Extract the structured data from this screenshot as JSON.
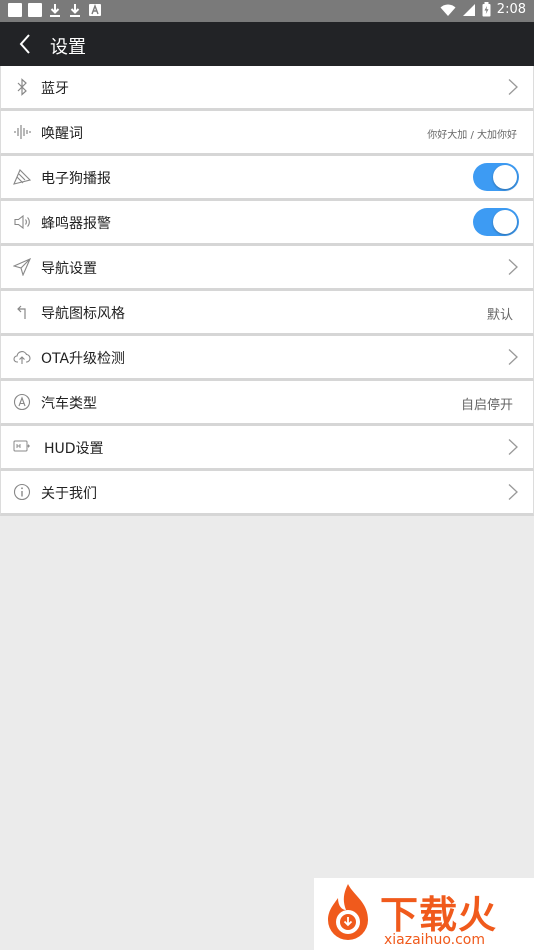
{
  "status_bar": {
    "time": "2:08"
  },
  "header": {
    "title": "设置"
  },
  "settings": [
    {
      "label": "蓝牙",
      "icon": "bluetooth-icon",
      "trailing": "chevron"
    },
    {
      "label": "唤醒词",
      "icon": "voice-wave-icon",
      "trailing": "value",
      "value": "你好大加 / 大加你好"
    },
    {
      "label": "电子狗播报",
      "icon": "radar-icon",
      "trailing": "toggle",
      "on": true
    },
    {
      "label": "蜂鸣器报警",
      "icon": "speaker-icon",
      "trailing": "toggle",
      "on": true
    },
    {
      "label": "导航设置",
      "icon": "navigation-icon",
      "trailing": "chevron"
    },
    {
      "label": "导航图标风格",
      "icon": "turn-arrow-icon",
      "trailing": "value",
      "value": "默认"
    },
    {
      "label": "OTA升级检测",
      "icon": "cloud-upload-icon",
      "trailing": "chevron"
    },
    {
      "label": "汽车类型",
      "icon": "auto-badge-icon",
      "trailing": "value",
      "value": "自启停开"
    },
    {
      "label": "HUD设置",
      "icon": "hud-icon",
      "trailing": "chevron"
    },
    {
      "label": "关于我们",
      "icon": "info-icon",
      "trailing": "chevron"
    }
  ],
  "watermark": {
    "brand": "下载火",
    "url": "xiazaihuo.com"
  },
  "colors": {
    "toggle_on": "#3d9bf3",
    "titlebar": "#222326",
    "brand": "#f05a1c"
  }
}
